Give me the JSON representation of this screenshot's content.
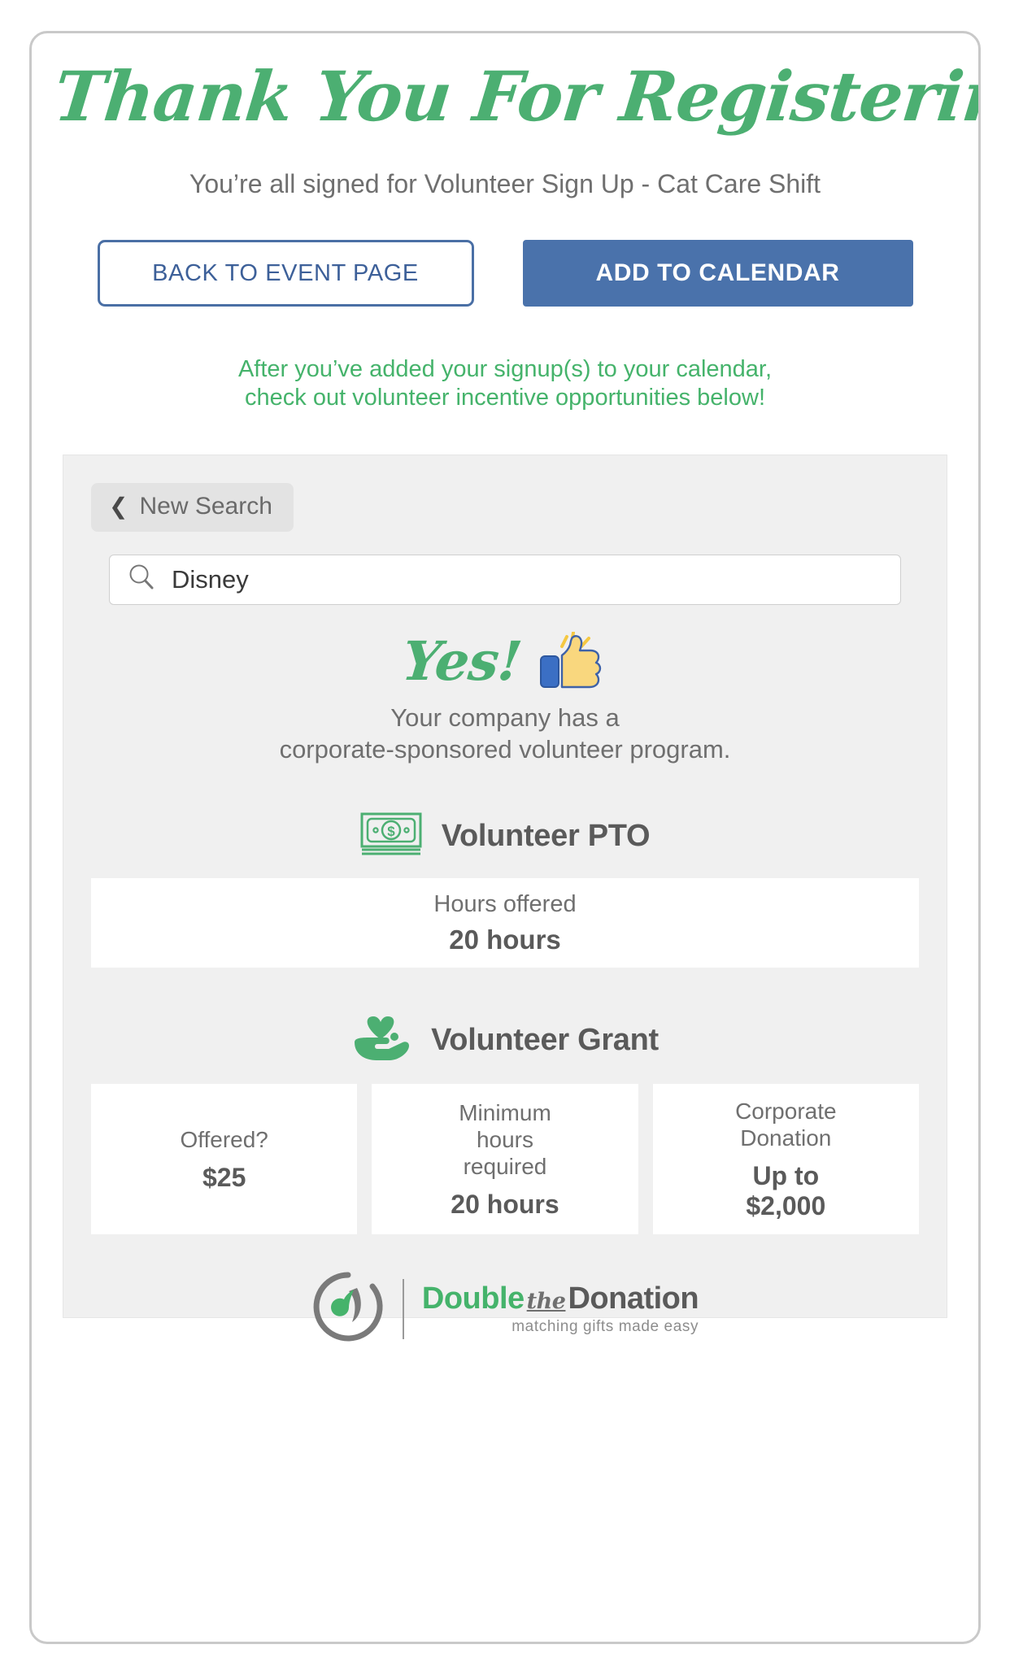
{
  "header": {
    "headline": "Thank You For Registering!",
    "subtitle": "You’re all signed for Volunteer Sign Up - Cat Care Shift",
    "back_button": "BACK TO EVENT PAGE",
    "calendar_button": "ADD TO CALENDAR",
    "note_line1": "After you’ve added your signup(s) to your calendar,",
    "note_line2": "check out volunteer incentive opportunities below!"
  },
  "panel": {
    "new_search": "New Search",
    "new_search_chevron": "❮",
    "search": {
      "value": "Disney",
      "placeholder": "Disney"
    },
    "result": {
      "yes_word": "Yes!",
      "desc_line1": "Your company has a",
      "desc_line2": "corporate-sponsored volunteer program."
    },
    "pto": {
      "title": "Volunteer PTO",
      "label": "Hours offered",
      "value": "20 hours"
    },
    "grant": {
      "title": "Volunteer Grant",
      "cards": [
        {
          "label": "Offered?",
          "value": "$25"
        },
        {
          "label": "Minimum\nhours\nrequired",
          "value": "20 hours"
        },
        {
          "label": "Corporate\nDonation",
          "value": "Up to\n$2,000"
        }
      ]
    },
    "logo": {
      "word1": "Double",
      "word2": "the",
      "word3": "Donation",
      "tagline": "matching gifts made easy"
    }
  },
  "colors": {
    "green": "#45b36b",
    "blue": "#4a72ab",
    "grey_text": "#6f6f6f",
    "panel_bg": "#f0f0f0"
  }
}
